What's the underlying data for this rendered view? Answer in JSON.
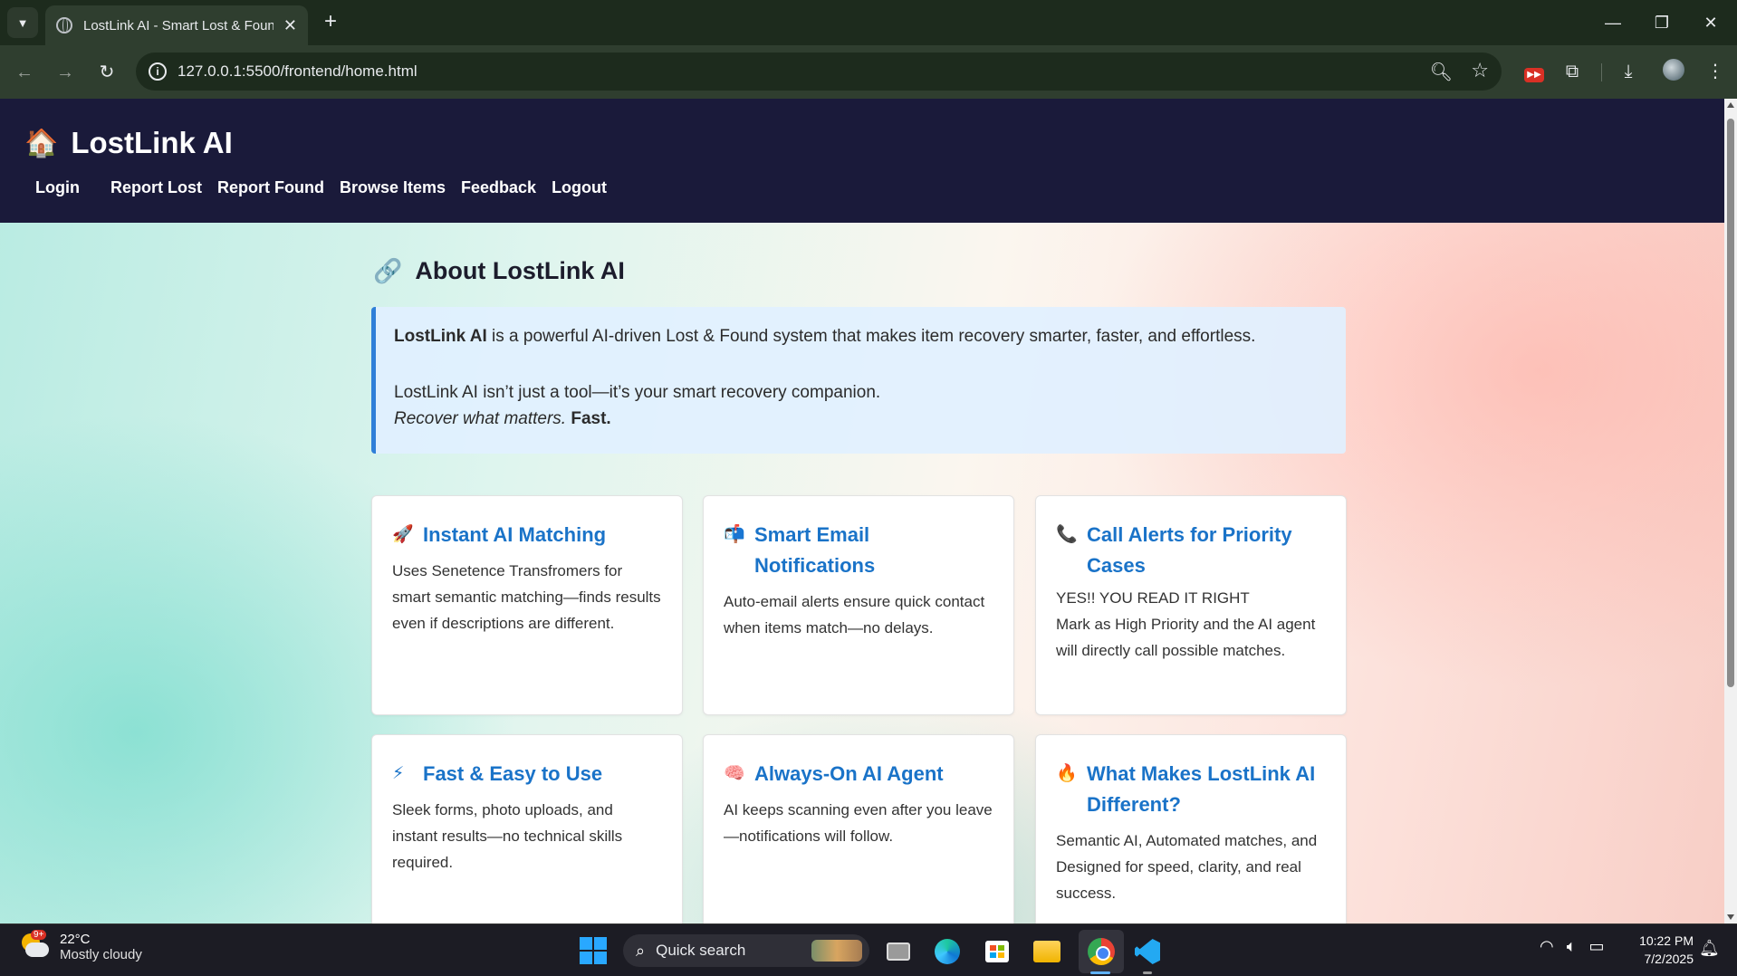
{
  "browser": {
    "tab_title": "LostLink AI - Smart Lost & Found",
    "new_tab_symbol": "+",
    "url": "127.0.0.1:5500/frontend/home.html"
  },
  "site": {
    "brand_icon": "🏠",
    "brand_name": "LostLink AI",
    "nav": [
      "Login",
      "Report Lost",
      "Report Found",
      "Browse Items",
      "Feedback",
      "Logout"
    ]
  },
  "about": {
    "title_icon": "🔗",
    "title": "About LostLink AI",
    "intro_bold": "LostLink AI",
    "intro_rest": " is a powerful AI-driven Lost & Found system that makes item recovery smarter, faster, and effortless.",
    "companion": "LostLink AI isn’t just a tool—it’s your smart recovery companion.",
    "tagline_italic": "Recover what matters.",
    "tagline_bold": "Fast."
  },
  "cards": [
    {
      "icon": "🚀",
      "title": "Instant AI Matching",
      "body": "Uses Senetence Transfromers for smart semantic matching—finds results even if descriptions are different."
    },
    {
      "icon": "📬",
      "title": "Smart Email Notifications",
      "body": "Auto-email alerts ensure quick contact when items match—no delays."
    },
    {
      "icon": "📞",
      "title": "Call Alerts for Priority Cases",
      "body_line1": "YES!! YOU READ IT RIGHT",
      "body": "Mark as High Priority and the AI agent will directly call possible matches."
    },
    {
      "icon": "⚡",
      "title": "Fast & Easy to Use",
      "body": "Sleek forms, photo uploads, and instant results—no technical skills required."
    },
    {
      "icon": "🧠",
      "title": "Always-On AI Agent",
      "body": "AI keeps scanning even after you leave—notifications will follow."
    },
    {
      "icon": "🔥",
      "title": "What Makes LostLink AI Different?",
      "body": "Semantic AI, Automated matches, and Designed for speed, clarity, and real success."
    }
  ],
  "taskbar": {
    "weather_badge": "9+",
    "temperature": "22°C",
    "weather_desc": "Mostly cloudy",
    "search_label": "Quick search",
    "time": "10:22 PM",
    "date": "7/2/2025"
  }
}
